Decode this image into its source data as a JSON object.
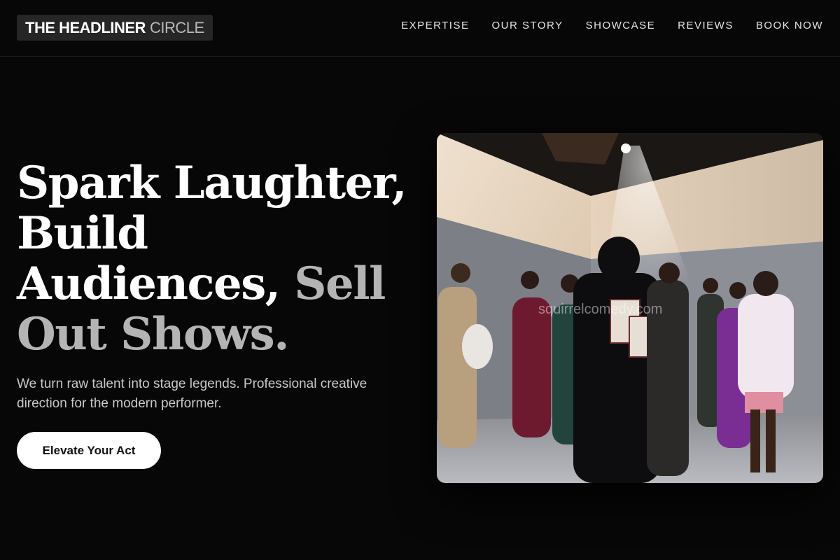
{
  "brand": {
    "name_bold": "THE HEADLINER",
    "name_light": "CIRCLE"
  },
  "nav": {
    "items": [
      {
        "label": "EXPERTISE"
      },
      {
        "label": "OUR STORY"
      },
      {
        "label": "SHOWCASE"
      },
      {
        "label": "REVIEWS"
      },
      {
        "label": "BOOK NOW"
      }
    ]
  },
  "hero": {
    "headline_part1": "Spark Laughter, Build Audiences,",
    "headline_part2": "Sell Out Shows.",
    "subtext": "We turn raw talent into stage legends. Professional creative direction for the modern performer.",
    "cta_label": "Elevate Your Act",
    "image_watermark": "squirrelcomedy.com"
  },
  "colors": {
    "background": "#070707",
    "text_primary": "#ffffff",
    "text_muted": "#b4b4b4",
    "button_bg": "#ffffff",
    "button_text": "#111111"
  }
}
